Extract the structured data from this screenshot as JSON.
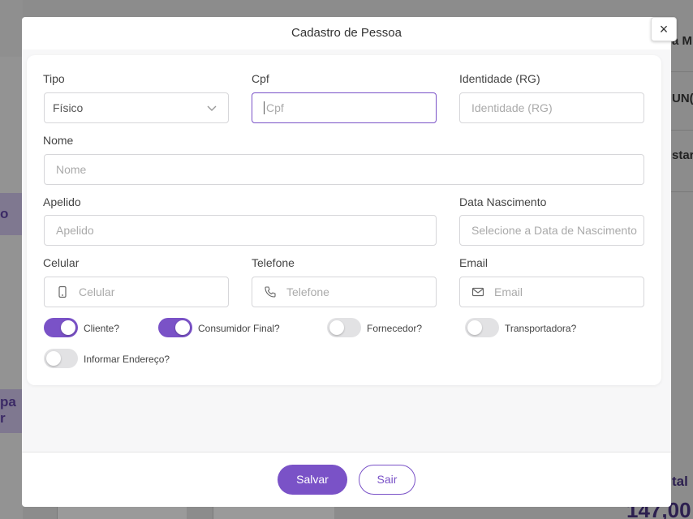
{
  "background": {
    "left_text_1": "o",
    "left_text_2": "pa",
    "left_text_3": "r",
    "right_text_1": "a M",
    "right_text_2": "UN(",
    "right_text_3": "star",
    "right_total": "tal",
    "right_price": "147,00"
  },
  "modal": {
    "title": "Cadastro de Pessoa",
    "close_label": "×",
    "fields": {
      "tipo": {
        "label": "Tipo",
        "value": "Físico"
      },
      "cpf": {
        "label": "Cpf",
        "placeholder": "Cpf"
      },
      "identidade": {
        "label": "Identidade (RG)",
        "placeholder": "Identidade (RG)"
      },
      "nome": {
        "label": "Nome",
        "placeholder": "Nome"
      },
      "apelido": {
        "label": "Apelido",
        "placeholder": "Apelido"
      },
      "data_nascimento": {
        "label": "Data Nascimento",
        "placeholder": "Selecione a Data de Nascimento"
      },
      "celular": {
        "label": "Celular",
        "placeholder": "Celular"
      },
      "telefone": {
        "label": "Telefone",
        "placeholder": "Telefone"
      },
      "email": {
        "label": "Email",
        "placeholder": "Email"
      }
    },
    "toggles": [
      {
        "label": "Cliente?",
        "on": true
      },
      {
        "label": "Consumidor Final?",
        "on": true
      },
      {
        "label": "Fornecedor?",
        "on": false
      },
      {
        "label": "Transportadora?",
        "on": false
      },
      {
        "label": "Informar Endereço?",
        "on": false
      }
    ],
    "buttons": {
      "save": "Salvar",
      "exit": "Sair"
    }
  },
  "colors": {
    "accent": "#7a52c7"
  }
}
